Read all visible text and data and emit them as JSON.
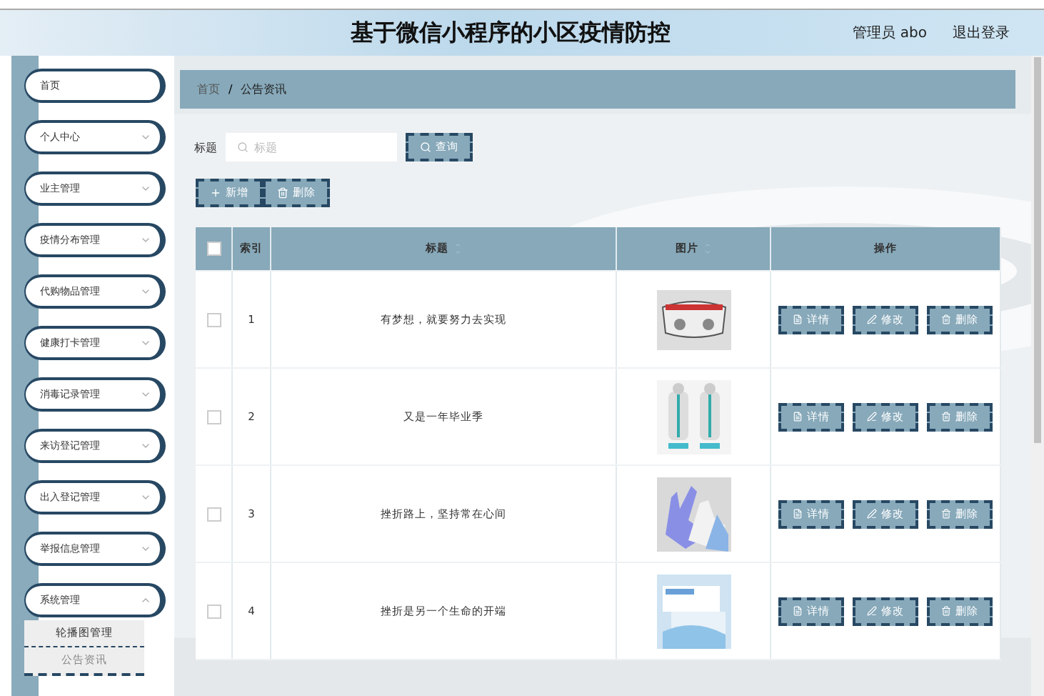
{
  "header": {
    "title": "基于微信小程序的小区疫情防控",
    "user": "管理员 abo",
    "logout": "退出登录"
  },
  "sidebar": {
    "items": [
      {
        "label": "首页",
        "kind": "link"
      },
      {
        "label": "个人中心",
        "kind": "group",
        "expanded": false
      },
      {
        "label": "业主管理",
        "kind": "group",
        "expanded": false
      },
      {
        "label": "疫情分布管理",
        "kind": "group",
        "expanded": false
      },
      {
        "label": "代购物品管理",
        "kind": "group",
        "expanded": false
      },
      {
        "label": "健康打卡管理",
        "kind": "group",
        "expanded": false
      },
      {
        "label": "消毒记录管理",
        "kind": "group",
        "expanded": false
      },
      {
        "label": "来访登记管理",
        "kind": "group",
        "expanded": false
      },
      {
        "label": "出入登记管理",
        "kind": "group",
        "expanded": false
      },
      {
        "label": "举报信息管理",
        "kind": "group",
        "expanded": false
      },
      {
        "label": "系统管理",
        "kind": "group",
        "expanded": true,
        "children": [
          {
            "label": "轮播图管理",
            "selected": false
          },
          {
            "label": "公告资讯",
            "selected": true
          }
        ]
      }
    ]
  },
  "breadcrumb": [
    "首页",
    "公告资讯"
  ],
  "breadcrumb_separator": "/",
  "search": {
    "label": "标题",
    "placeholder": "标题",
    "button": "查询"
  },
  "actions": [
    "新增",
    "删除"
  ],
  "table": {
    "all_checked": false,
    "columns": [
      "索引",
      "标题",
      "图片",
      "操作"
    ],
    "rows": [
      {
        "checked": false,
        "index": "1",
        "title": "有梦想，就要努力去实现",
        "buttons": [
          "详情",
          "修改",
          "删除"
        ]
      },
      {
        "checked": false,
        "index": "2",
        "title": "又是一年毕业季",
        "buttons": [
          "详情",
          "修改",
          "删除"
        ]
      },
      {
        "checked": false,
        "index": "3",
        "title": "挫折路上，坚持常在心间",
        "buttons": [
          "详情",
          "修改",
          "删除"
        ]
      },
      {
        "checked": false,
        "index": "4",
        "title": "挫折是另一个生命的开端",
        "buttons": [
          "详情",
          "修改",
          "删除"
        ]
      }
    ]
  }
}
